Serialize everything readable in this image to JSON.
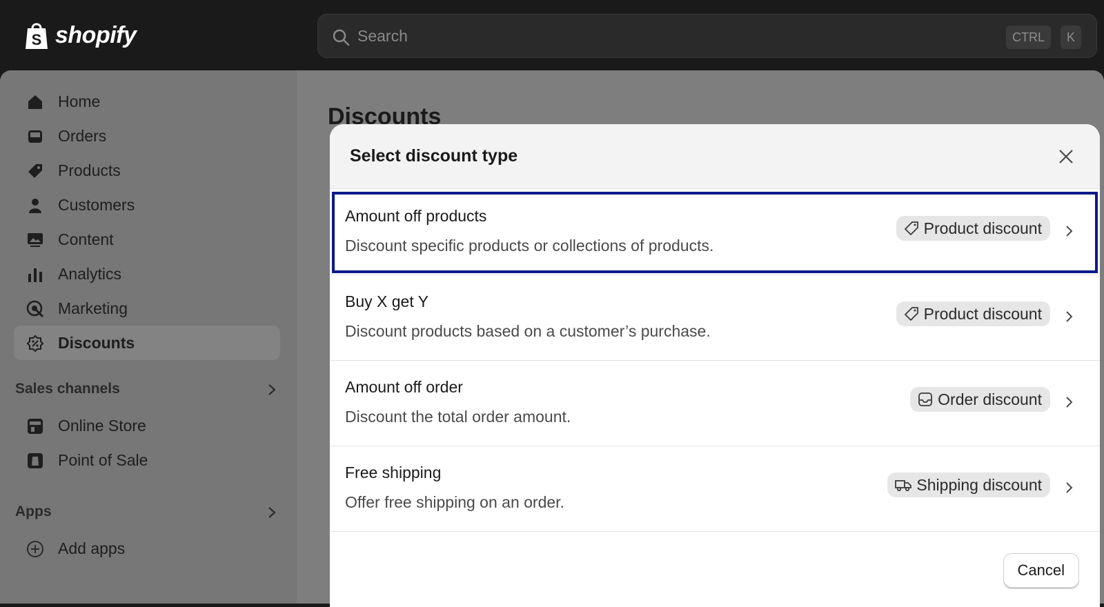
{
  "brand": {
    "name": "shopify"
  },
  "search": {
    "placeholder": "Search",
    "shortcut_keys": [
      "CTRL",
      "K"
    ]
  },
  "sidebar": {
    "items": [
      {
        "label": "Home",
        "icon": "home-icon"
      },
      {
        "label": "Orders",
        "icon": "inbox-icon"
      },
      {
        "label": "Products",
        "icon": "tag-icon"
      },
      {
        "label": "Customers",
        "icon": "person-icon"
      },
      {
        "label": "Content",
        "icon": "image-icon"
      },
      {
        "label": "Analytics",
        "icon": "bar-chart-icon"
      },
      {
        "label": "Marketing",
        "icon": "target-icon"
      },
      {
        "label": "Discounts",
        "icon": "discount-icon",
        "active": true
      }
    ],
    "sales_channels": {
      "label": "Sales channels",
      "items": [
        {
          "label": "Online Store",
          "icon": "store-icon"
        },
        {
          "label": "Point of Sale",
          "icon": "pos-icon"
        }
      ]
    },
    "apps": {
      "label": "Apps",
      "items": [
        {
          "label": "Add apps",
          "icon": "plus-circle-icon"
        }
      ]
    }
  },
  "main": {
    "title": "Discounts"
  },
  "modal": {
    "title": "Select discount type",
    "options": [
      {
        "title": "Amount off products",
        "description": "Discount specific products or collections of products.",
        "badge": "Product discount",
        "badge_icon": "tag-icon",
        "selected": true
      },
      {
        "title": "Buy X get Y",
        "description": "Discount products based on a customer’s purchase.",
        "badge": "Product discount",
        "badge_icon": "tag-icon"
      },
      {
        "title": "Amount off order",
        "description": "Discount the total order amount.",
        "badge": "Order discount",
        "badge_icon": "order-icon"
      },
      {
        "title": "Free shipping",
        "description": "Offer free shipping on an order.",
        "badge": "Shipping discount",
        "badge_icon": "truck-icon"
      }
    ],
    "cancel_label": "Cancel"
  },
  "colors": {
    "selection_outline": "#0b1a8a",
    "topbar": "#1a1a1a",
    "overlay": "#7e7e7e"
  }
}
